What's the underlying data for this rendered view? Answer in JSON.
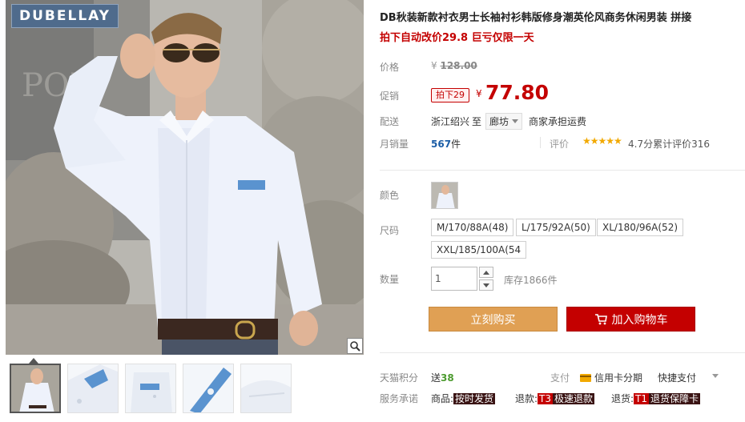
{
  "gallery": {
    "brand_logo": "DUBELLAY",
    "zoom_icon": "magnifier-icon",
    "thumbnails": [
      "thumb-1",
      "thumb-2",
      "thumb-3",
      "thumb-4",
      "thumb-5"
    ]
  },
  "product": {
    "title": "DB秋装新款衬衣男士长袖衬衫韩版修身潮英伦风商务休闲男装 拼接",
    "subtitle": "拍下自动改价29.8 巨亏仅限一天"
  },
  "price": {
    "label": "价格",
    "original_symbol": "¥",
    "original": "128.00",
    "promo_label": "促销",
    "promo_tag": "拍下29",
    "symbol": "¥",
    "current": "77.80"
  },
  "shipping": {
    "label": "配送",
    "from": "浙江绍兴",
    "to_label": "至",
    "destination": "廊坊",
    "fee": "商家承担运费"
  },
  "sales": {
    "label": "月销量",
    "count": "567",
    "unit": "件",
    "review_label": "评价",
    "stars": "★★★★★",
    "review_text": "4.7分累计评价316"
  },
  "options": {
    "color_label": "颜色",
    "size_label": "尺码",
    "sizes": [
      "M/170/88A(48)",
      "L/175/92A(50)",
      "XL/180/96A(52)",
      "XXL/185/100A(54"
    ]
  },
  "quantity": {
    "label": "数量",
    "value": "1",
    "stock": "库存1866件"
  },
  "actions": {
    "buy_now": "立刻购买",
    "add_to_cart": "加入购物车"
  },
  "extras": {
    "points_label": "天猫积分",
    "points_prefix": "送",
    "points": "38",
    "pay_label": "支付",
    "card_pay": "信用卡分期",
    "quick_pay": "快捷支付",
    "service_label": "服务承诺",
    "service_1_prefix": "商品:",
    "service_1_tag": "按时发货",
    "service_2_prefix": "退款:",
    "service_2_code": "T3",
    "service_2_tag": "极速退款",
    "service_3_prefix": "退货:",
    "service_3_code": "T1",
    "service_3_tag": "退货保障卡"
  },
  "colors": {
    "accent_red": "#c40000",
    "buy_orange": "#e0a054",
    "sales_blue": "#1b5da6",
    "points_green": "#4c9b2f"
  }
}
